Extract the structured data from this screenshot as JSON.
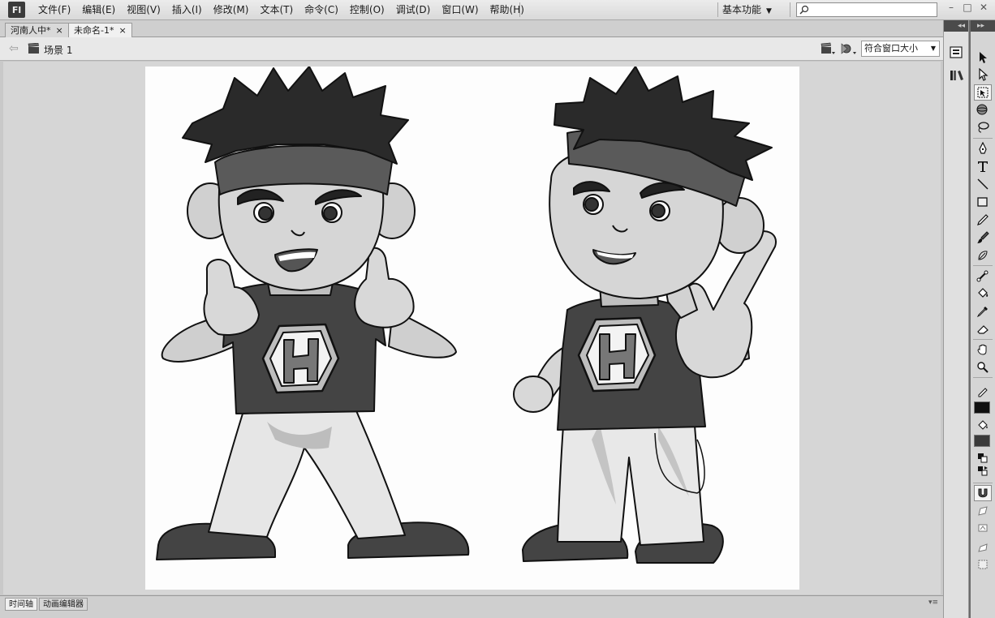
{
  "app": {
    "logo": "Fl"
  },
  "menu": [
    "文件(F)",
    "编辑(E)",
    "视图(V)",
    "插入(I)",
    "修改(M)",
    "文本(T)",
    "命令(C)",
    "控制(O)",
    "调试(D)",
    "窗口(W)",
    "帮助(H)"
  ],
  "workspace": {
    "label": "基本功能"
  },
  "search": {
    "placeholder": ""
  },
  "window_controls": {
    "minimize": "–",
    "restore": "□",
    "close": "✕"
  },
  "tabs": [
    {
      "label": "河南人中*",
      "close": "×",
      "active": false
    },
    {
      "label": "未命名-1*",
      "close": "×",
      "active": true
    }
  ],
  "editbar": {
    "scene_label": "场景 1",
    "zoom_value": "符合窗口大小"
  },
  "bottom_tabs": [
    {
      "label": "时间轴",
      "active": true
    },
    {
      "label": "动画编辑器",
      "active": false
    }
  ],
  "panel": {
    "collapse": "◂◂",
    "expand": "▸▸",
    "menu": "▾≡"
  },
  "colors": {
    "stroke": "#101010",
    "fill": "#3a3a3a",
    "stage": "#fdfdfd",
    "pasteboard": "#d6d6d6"
  },
  "tools": [
    "selection-tool",
    "subselection-tool",
    "free-transform-tool",
    "3d-rotation-tool",
    "lasso-tool",
    "pen-tool",
    "text-tool",
    "line-tool",
    "rectangle-tool",
    "pencil-tool",
    "brush-tool",
    "deco-tool",
    "bone-tool",
    "paint-bucket-tool",
    "eyedropper-tool",
    "eraser-tool",
    "hand-tool",
    "zoom-tool"
  ]
}
